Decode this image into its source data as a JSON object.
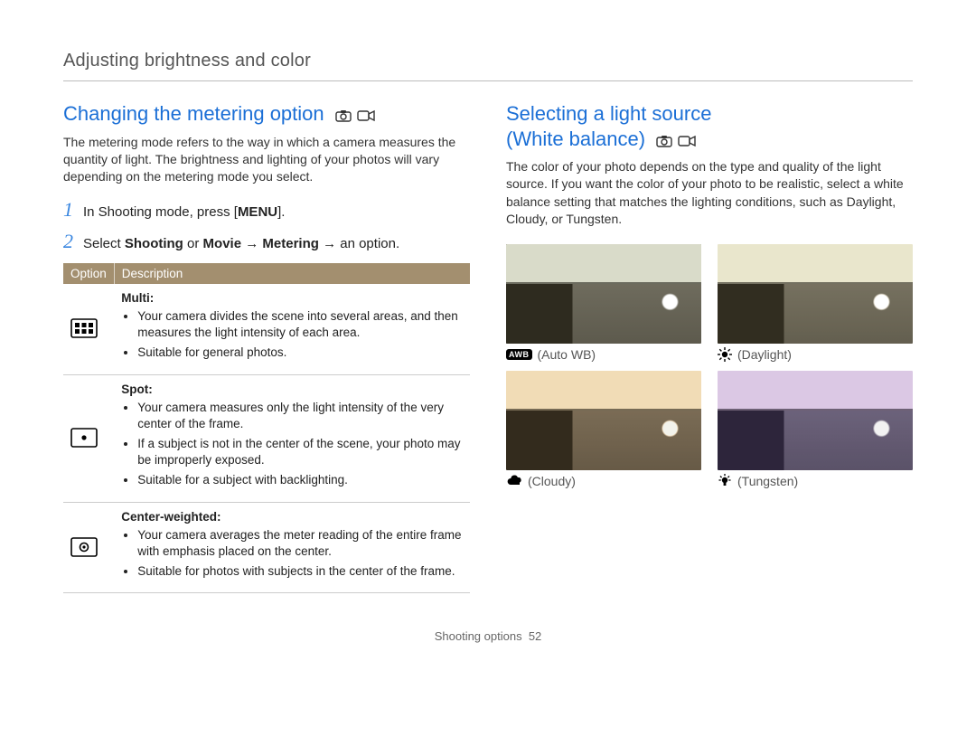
{
  "header": {
    "title": "Adjusting brightness and color"
  },
  "left": {
    "heading": "Changing the metering option",
    "intro": "The metering mode refers to the way in which a camera measures the quantity of light. The brightness and lighting of your photos will vary depending on the metering mode you select.",
    "steps": {
      "s1_a": "In Shooting mode, press [",
      "s1_menu": "MENU",
      "s1_b": "].",
      "s2_a": "Select ",
      "s2_shooting": "Shooting",
      "s2_or": " or ",
      "s2_movie": "Movie",
      "s2_arrow1": " → ",
      "s2_metering": "Metering",
      "s2_arrow2": " → an option."
    },
    "table": {
      "head_option": "Option",
      "head_desc": "Description",
      "rows": [
        {
          "icon": "metering-multi",
          "title": "Multi",
          "bullets": [
            "Your camera divides the scene into several areas, and then measures the light intensity of each area.",
            "Suitable for general photos."
          ]
        },
        {
          "icon": "metering-spot",
          "title": "Spot",
          "bullets": [
            "Your camera measures only the light intensity of the very center of the frame.",
            "If a subject is not in the center of the scene, your photo may be improperly exposed.",
            "Suitable for a subject with backlighting."
          ]
        },
        {
          "icon": "metering-center",
          "title": "Center-weighted",
          "bullets": [
            "Your camera averages the meter reading of the entire frame with emphasis placed on the center.",
            "Suitable for photos with subjects in the center of the frame."
          ]
        }
      ]
    }
  },
  "right": {
    "heading_l1": "Selecting a light source",
    "heading_l2": "(White balance)",
    "intro": "The color of your photo depends on the type and quality of the light source. If you want the color of your photo to be realistic, select a white balance setting that matches the lighting conditions, such as Daylight, Cloudy, or Tungsten.",
    "wb": [
      {
        "icon": "awb",
        "label": "(Auto WB)",
        "tint": ""
      },
      {
        "icon": "daylight",
        "label": "(Daylight)",
        "tint": "tint-warm"
      },
      {
        "icon": "cloudy",
        "label": "(Cloudy)",
        "tint": "tint-cloudy"
      },
      {
        "icon": "tungsten",
        "label": "(Tungsten)",
        "tint": "tint-tungsten"
      }
    ]
  },
  "footer": {
    "section": "Shooting options",
    "page": "52"
  },
  "icons": {
    "awb_text": "AWB"
  }
}
